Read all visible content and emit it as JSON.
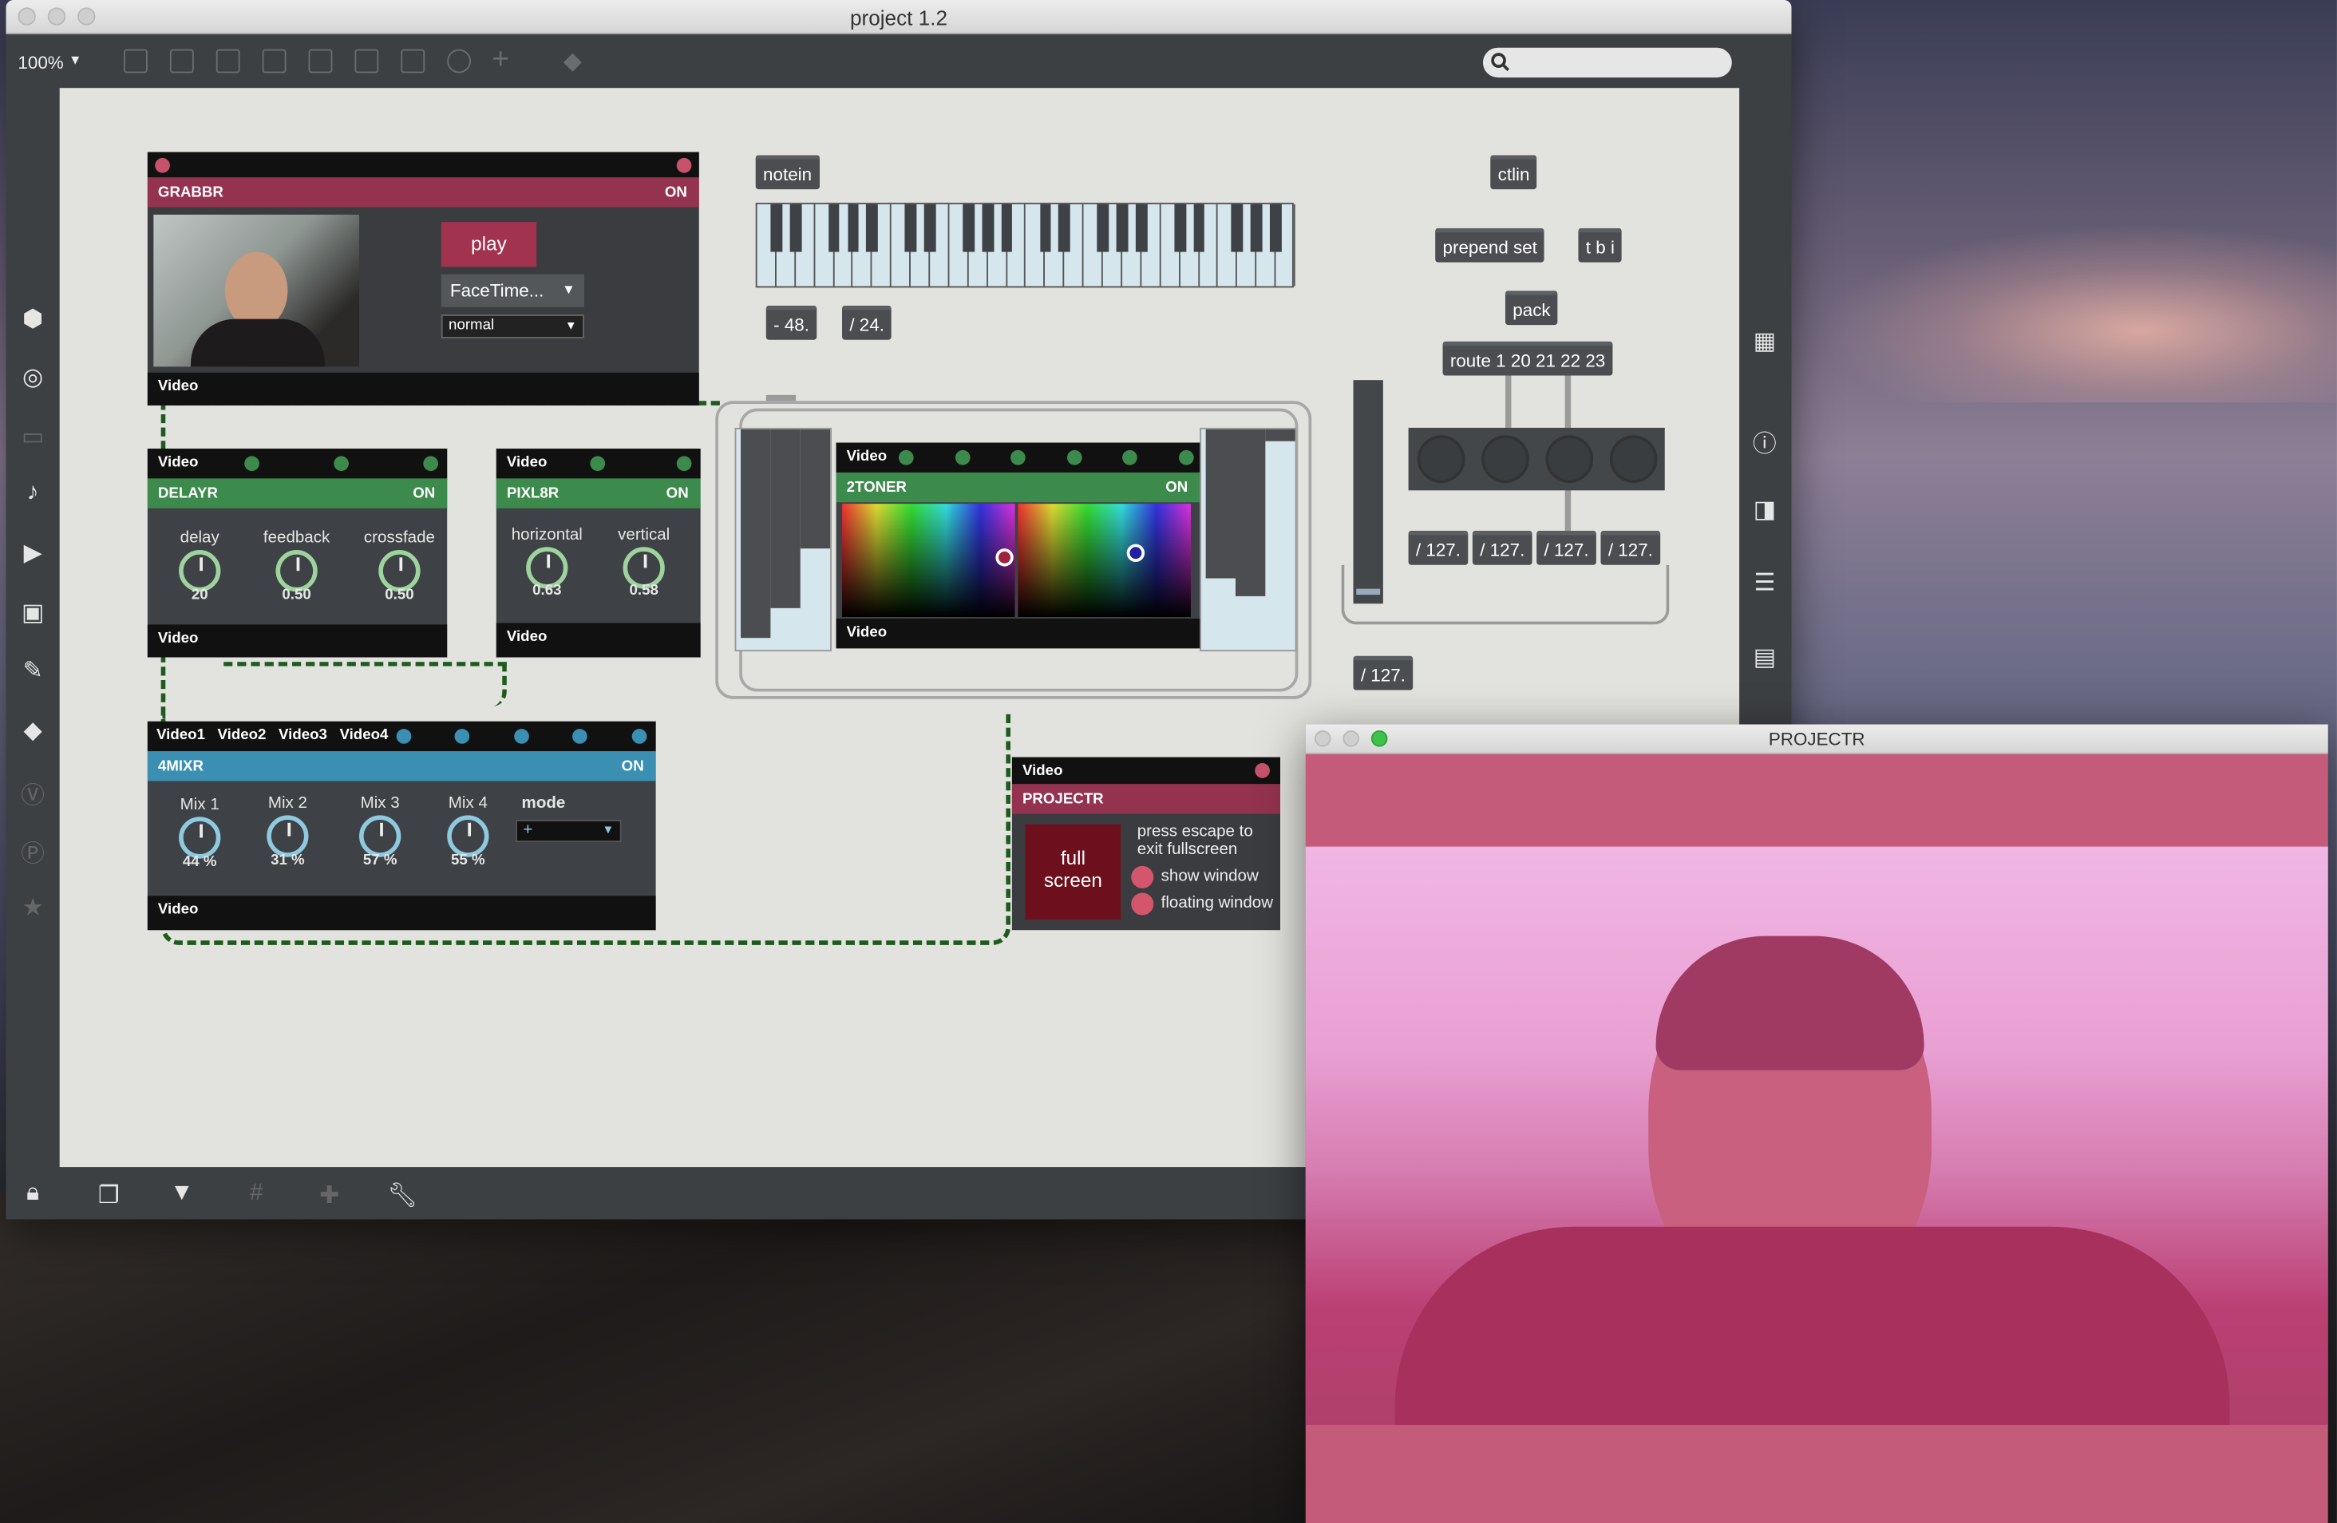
{
  "window": {
    "title": "project 1.2",
    "zoom": "100%",
    "search_placeholder": ""
  },
  "modules": {
    "grabbr": {
      "title": "GRABBR",
      "status": "ON",
      "play_label": "play",
      "device": "FaceTime...",
      "mode": "normal",
      "out_label": "Video"
    },
    "delayr": {
      "in_label": "Video",
      "title": "DELAYR",
      "status": "ON",
      "out_label": "Video",
      "knobs": [
        {
          "label": "delay",
          "value": "20"
        },
        {
          "label": "feedback",
          "value": "0.50"
        },
        {
          "label": "crossfade",
          "value": "0.50"
        }
      ]
    },
    "pixl8r": {
      "in_label": "Video",
      "title": "PIXL8R",
      "status": "ON",
      "out_label": "Video",
      "knobs": [
        {
          "label": "horizontal",
          "value": "0.63"
        },
        {
          "label": "vertical",
          "value": "0.58"
        }
      ]
    },
    "twotoner": {
      "in_label": "Video",
      "title": "2TONER",
      "status": "ON",
      "out_label": "Video"
    },
    "mixr": {
      "in_labels": [
        "Video1",
        "Video2",
        "Video3",
        "Video4"
      ],
      "title": "4MIXR",
      "status": "ON",
      "out_label": "Video",
      "knobs": [
        {
          "label": "Mix 1",
          "value": "44 %"
        },
        {
          "label": "Mix 2",
          "value": "31 %"
        },
        {
          "label": "Mix 3",
          "value": "57 %"
        },
        {
          "label": "Mix 4",
          "value": "55 %"
        }
      ],
      "mode_label": "mode",
      "mode_value": "+"
    },
    "projectr": {
      "in_label": "Video",
      "title": "PROJECTR",
      "fullscreen_label": "full\nscreen",
      "hint": "press escape to exit fullscreen",
      "show_window": "show window",
      "floating_window": "floating window"
    }
  },
  "objects": {
    "notein": "notein",
    "minus48": "- 48.",
    "div24": "/ 24.",
    "ctlin": "ctlin",
    "prepend": "prepend set",
    "tbi": "t b i",
    "pack": "pack",
    "route": "route 1 20 21 22 23",
    "div127a": "/ 127.",
    "div127b": "/ 127.",
    "div127c": "/ 127.",
    "div127d": "/ 127.",
    "div127e": "/ 127."
  },
  "projector_window": {
    "title": "PROJECTR"
  },
  "colors": {
    "grabbr": "#93334f",
    "delayr": "#3d8a4d",
    "mixr": "#3a8fb3",
    "canvas": "#e2e2de"
  }
}
